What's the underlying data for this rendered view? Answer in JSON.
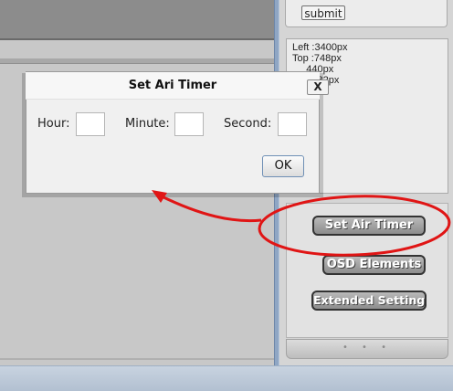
{
  "right_panel": {
    "submit_label": "submit",
    "info_lines": [
      "Left :3400px",
      "Top :748px",
      "     440px",
      "      :332px"
    ]
  },
  "buttons": {
    "set_air_timer": "Set Air Timer",
    "osd_elements": "OSD Elements",
    "extended_settings": "Extended Settings"
  },
  "pager": {
    "dots": "• • •"
  },
  "dialog": {
    "title": "Set Ari Timer",
    "close_label": "X",
    "hour_label": "Hour:",
    "minute_label": "Minute:",
    "second_label": "Second:",
    "hour_value": "",
    "minute_value": "",
    "second_value": "",
    "ok_label": "OK"
  },
  "annotation": {
    "color": "#e01515"
  }
}
